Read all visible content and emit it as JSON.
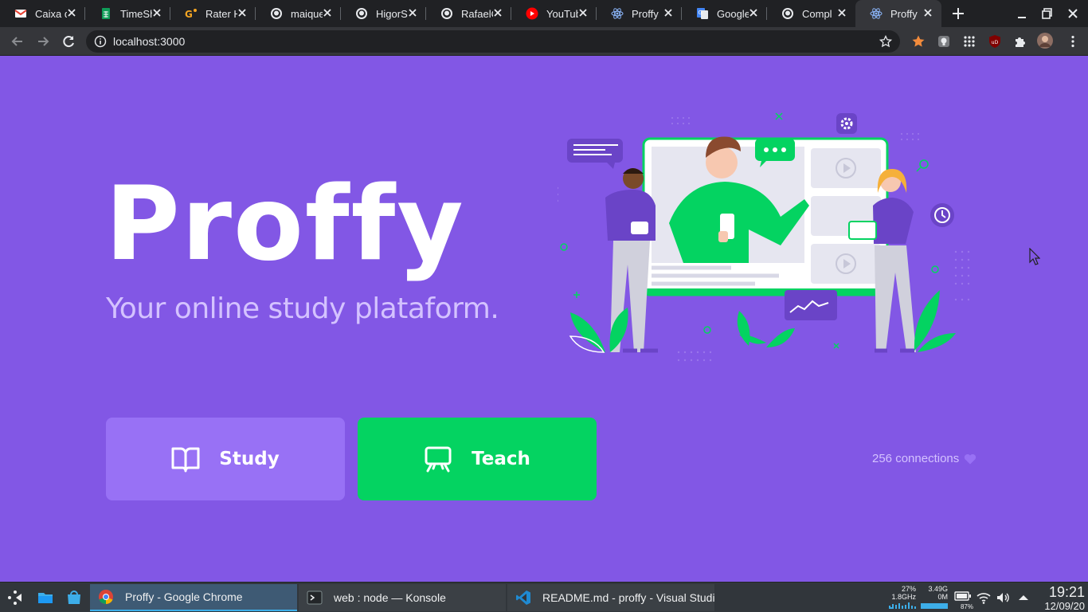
{
  "browser": {
    "tabs": [
      {
        "title": "Caixa de",
        "icon": "gmail-icon",
        "active": false
      },
      {
        "title": "TimeSh",
        "icon": "sheets-icon",
        "active": false
      },
      {
        "title": "Rater H",
        "icon": "rater-icon",
        "active": false
      },
      {
        "title": "maique",
        "icon": "github-icon",
        "active": false
      },
      {
        "title": "HigorS",
        "icon": "github-icon",
        "active": false
      },
      {
        "title": "RafaelC",
        "icon": "github-icon",
        "active": false
      },
      {
        "title": "YouTub",
        "icon": "youtube-icon",
        "active": false
      },
      {
        "title": "Proffy",
        "icon": "react-icon",
        "active": false
      },
      {
        "title": "Google",
        "icon": "google-translate-icon",
        "active": false
      },
      {
        "title": "Compl",
        "icon": "github-icon",
        "active": false
      },
      {
        "title": "Proffy",
        "icon": "react-icon",
        "active": true
      }
    ],
    "url": "localhost:3000"
  },
  "page": {
    "logo": "Proffy",
    "tagline": "Your online study plataform.",
    "study_label": "Study",
    "teach_label": "Teach",
    "connections_text": "256 connections",
    "colors": {
      "background": "#8257e5",
      "study": "#9871f5",
      "teach": "#04d361",
      "tagline": "#d4c2ff"
    }
  },
  "taskbar": {
    "tasks": [
      {
        "label": "Proffy - Google Chrome",
        "icon": "chrome-icon",
        "active": true
      },
      {
        "label": "web : node — Konsole",
        "icon": "konsole-icon",
        "active": false
      },
      {
        "label": "README.md - proffy - Visual Studi...",
        "icon": "vscode-icon",
        "active": false
      }
    ],
    "cpu_percent": "27%",
    "cpu_freq": "1.8GHz",
    "mem_total": "3.49G",
    "mem_used": "0M",
    "battery": "87%",
    "time": "19:21",
    "date": "12/09/20"
  }
}
